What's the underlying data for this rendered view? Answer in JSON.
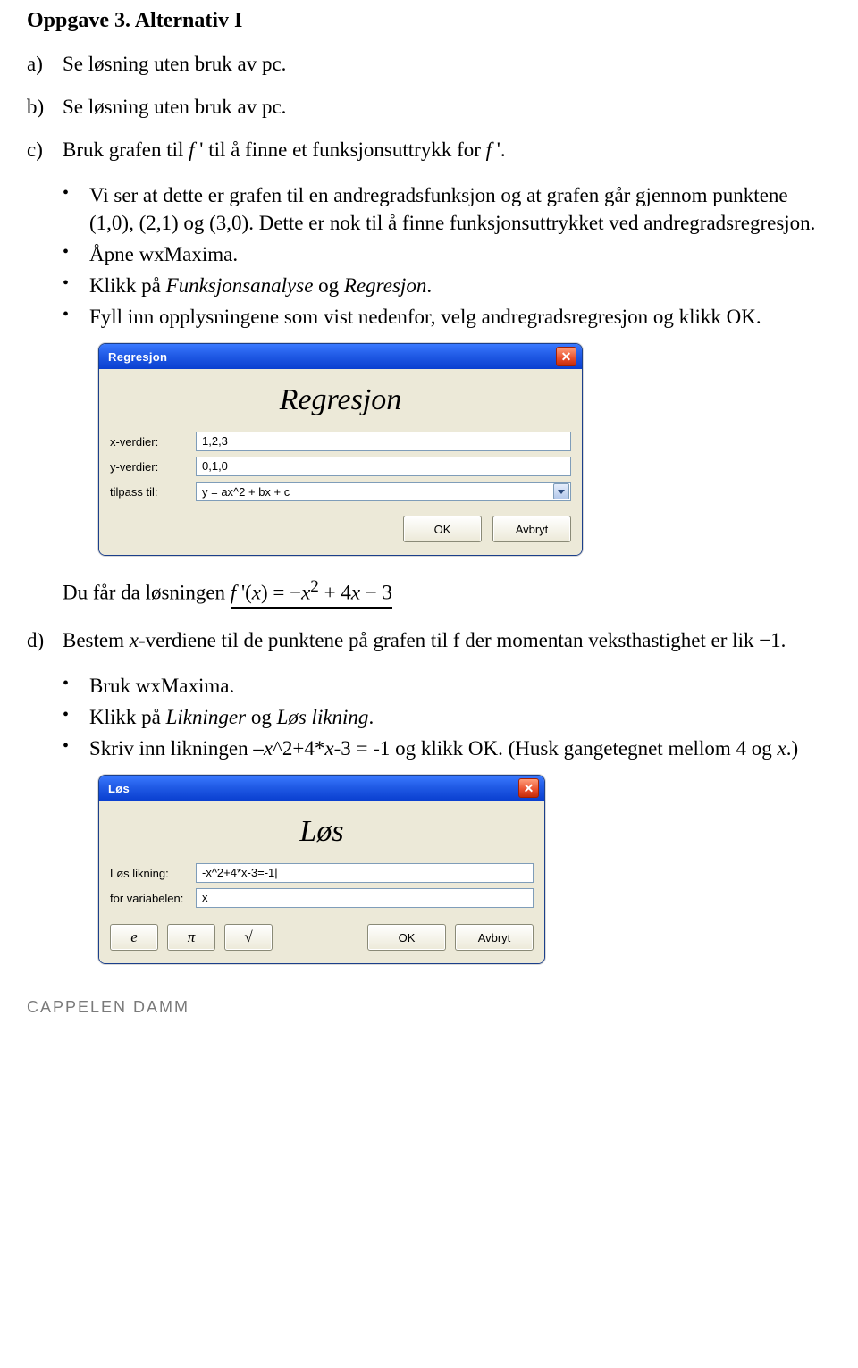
{
  "title": "Oppgave 3. Alternativ I",
  "lettered": {
    "a": {
      "letter": "a)",
      "text": "Se løsning uten bruk av pc."
    },
    "b": {
      "letter": "b)",
      "text": "Se løsning uten bruk av pc."
    },
    "c": {
      "letter": "c)",
      "pre": "Bruk grafen til ",
      "f_italic": "f",
      " mid": " ' til å finne et funksjonsuttrykk for ",
      "tail": " '.",
      "text_full": "Bruk grafen til f ' til å finne et funksjonsuttrykk for f '."
    },
    "d": {
      "letter": "d)",
      "text": "Bestem x-verdiene til de punktene på grafen til f der momentan veksthastighet er lik −1."
    }
  },
  "bullets_c": [
    "Vi ser at dette er grafen til en andregradsfunksjon og at grafen går gjennom punktene (1,0), (2,1) og (3,0). Dette er nok til å finne funksjonsuttrykket ved andregradsregresjon.",
    "Åpne wxMaxima.",
    "Klikk på Funksjonsanalyse og Regresjon.",
    "Fyll inn opplysningene som vist nedenfor, velg andregradsregresjon og klikk OK."
  ],
  "bullets_c_emph": {
    "2": {
      "plain_pre": "Klikk på ",
      "em1": "Funksjonsanalyse",
      "mid": " og ",
      "em2": "Regresjon",
      "tail": "."
    }
  },
  "dialog_reg": {
    "title": "Regresjon",
    "header": "Regresjon",
    "labels": {
      "x": "x-verdier:",
      "y": "y-verdier:",
      "fit": "tilpass til:"
    },
    "values": {
      "x": "1,2,3",
      "y": "0,1,0",
      "fit": "y = ax^2 + bx + c"
    },
    "buttons": {
      "ok": "OK",
      "cancel": "Avbryt"
    }
  },
  "solution_line": {
    "pre": "Du får da løsningen ",
    "eq": "f '(x) = −x² + 4x − 3"
  },
  "bullets_d": [
    "Bruk wxMaxima.",
    "Klikk på Likninger og Løs likning.",
    "Skriv inn likningen –x^2+4*x-3 = -1 og klikk OK. (Husk gangetegnet mellom 4 og x.)"
  ],
  "bullets_d_emph": {
    "1": {
      "plain_pre": "Klikk på ",
      "em1": "Likninger",
      "mid": " og ",
      "em2": "Løs likning",
      "tail": "."
    },
    "2": {
      "pre": "Skriv inn likningen –",
      "ital": "x",
      "post1": "^2+4*",
      "ital2": "x",
      "post2": "-3 = -1 og klikk OK. (Husk gangetegnet mellom 4 og ",
      "ital3": "x",
      "post3": ".)"
    }
  },
  "dialog_los": {
    "title": "Løs",
    "header": "Løs",
    "labels": {
      "eqn": "Løs likning:",
      "var": "for variabelen:"
    },
    "values": {
      "eqn": "-x^2+4*x-3=-1|",
      "var": "x"
    },
    "sym_buttons": {
      "e": "e",
      "pi": "π",
      "sqrt": "√"
    },
    "buttons": {
      "ok": "OK",
      "cancel": "Avbryt"
    }
  },
  "publisher": "CAPPELEN DAMM"
}
